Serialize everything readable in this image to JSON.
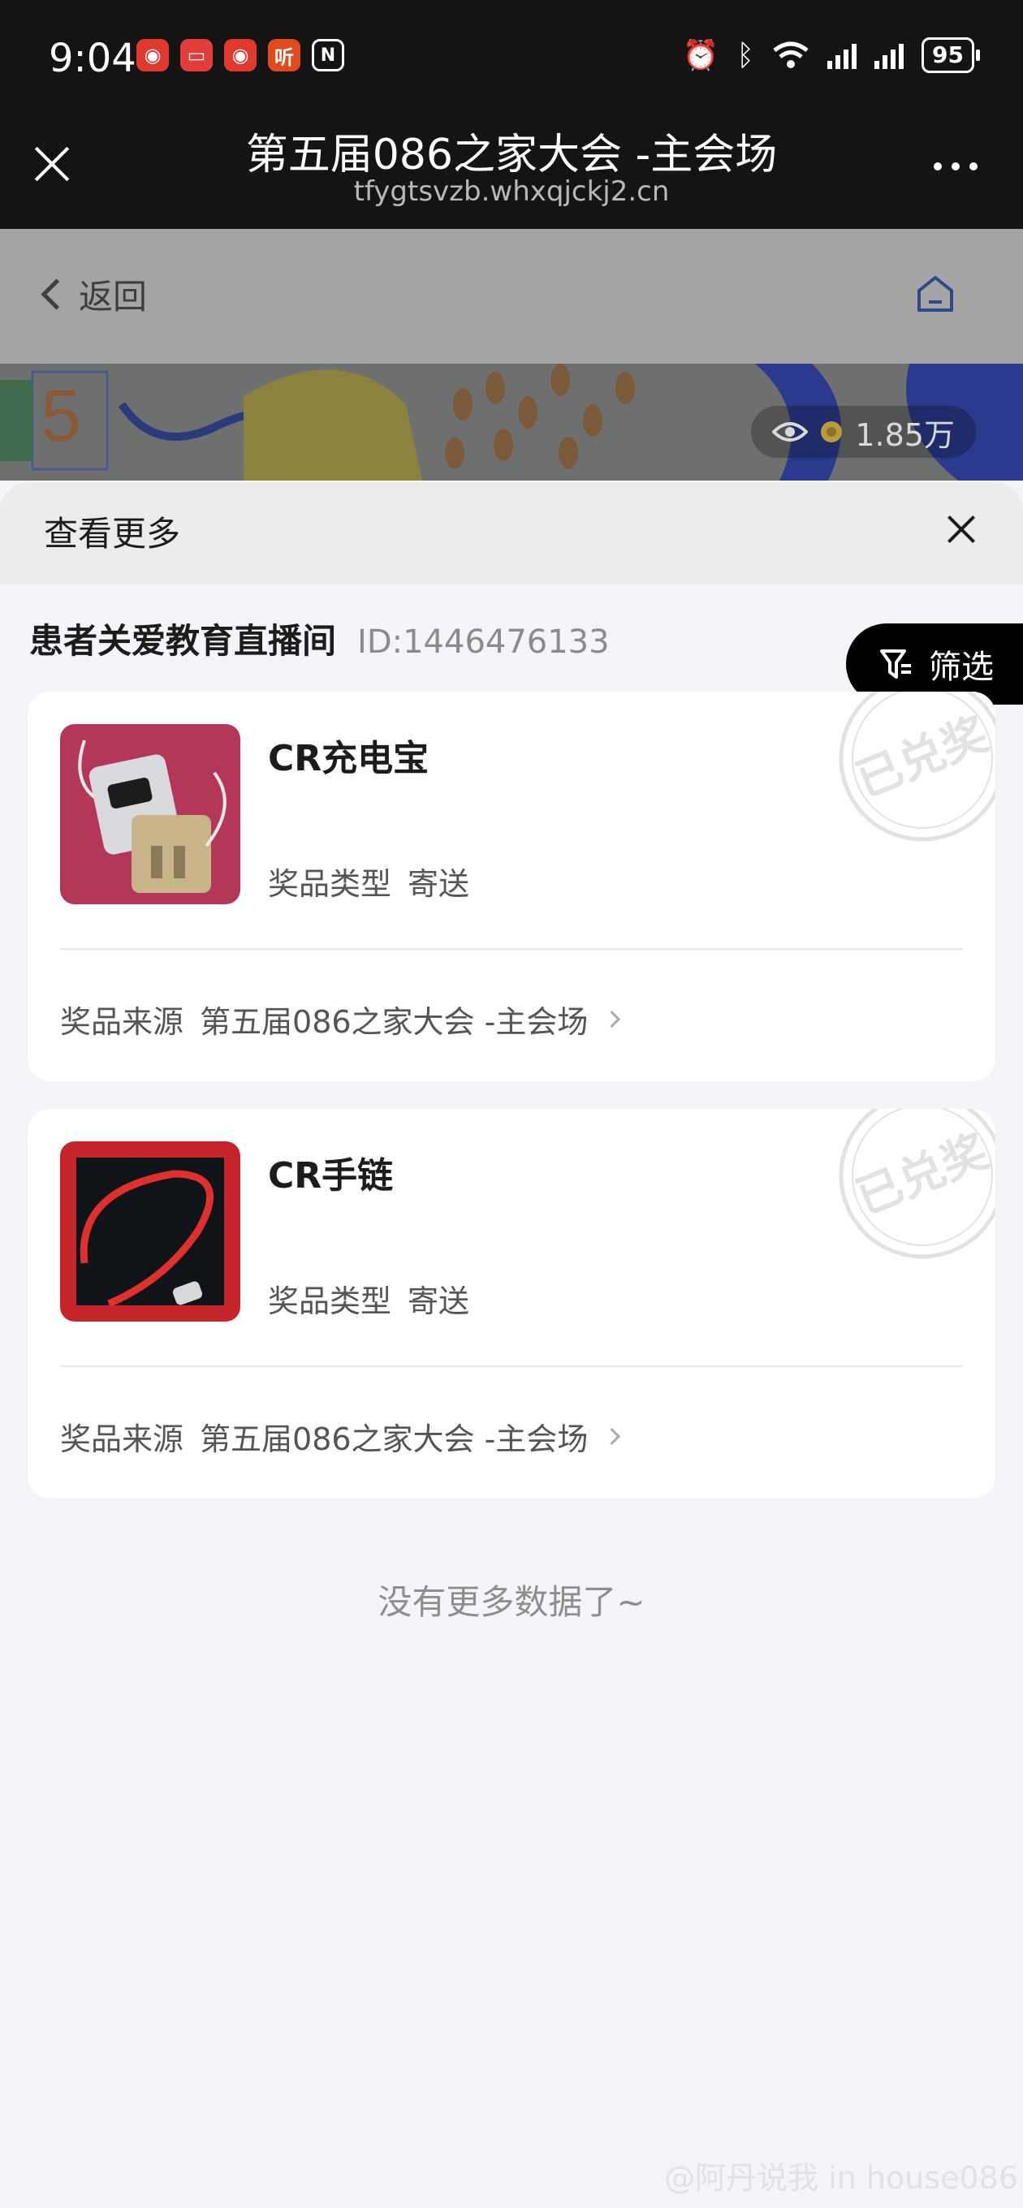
{
  "status_bar": {
    "time": "9:04",
    "apps": [
      {
        "name": "weibo-icon",
        "color": "#e03a2e"
      },
      {
        "name": "notes-icon",
        "color": "#e43b3b"
      },
      {
        "name": "weibo-icon",
        "color": "#e03a2e"
      },
      {
        "name": "ting-icon",
        "color": "#e04a1c",
        "text": "听"
      },
      {
        "name": "nfc-icon",
        "color": "#141414"
      }
    ],
    "battery": "95"
  },
  "titlebar": {
    "title": "第五届086之家大会 -主会场",
    "url": "tfygtsvzb.whxqjckj2.cn"
  },
  "webpage": {
    "back_label": "返回",
    "viewers": "1.85万"
  },
  "sheet": {
    "title": "查看更多",
    "room_name": "患者关爱教育直播间",
    "room_id": "ID:1446476133",
    "filter_label": "筛选",
    "type_label": "奖品类型",
    "source_label": "奖品来源",
    "stamp_text": "已兑奖",
    "prizes": [
      {
        "name": "CR充电宝",
        "type": "寄送",
        "source": "第五届086之家大会 -主会场"
      },
      {
        "name": "CR手链",
        "type": "寄送",
        "source": "第五届086之家大会 -主会场"
      }
    ],
    "no_more": "没有更多数据了~"
  },
  "watermark": "@阿丹说我 in house086"
}
